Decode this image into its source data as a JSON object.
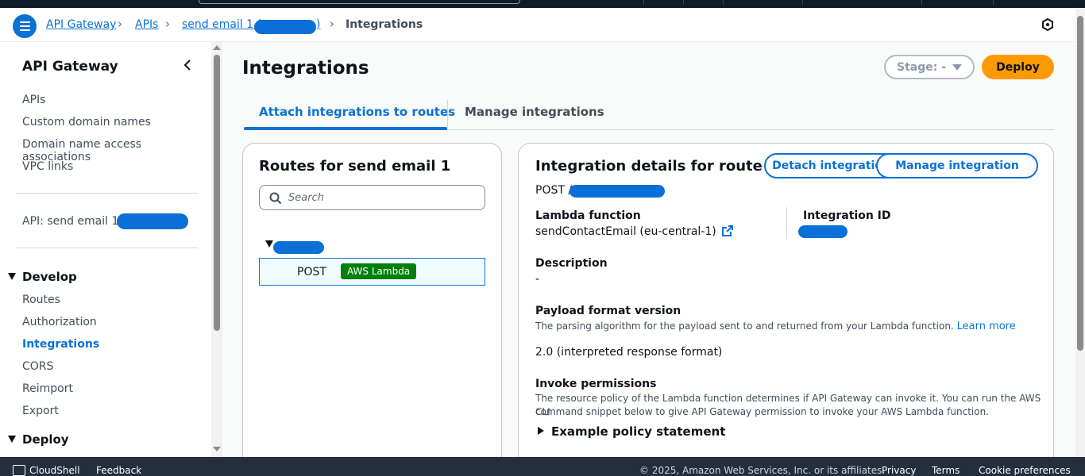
{
  "breadcrumb": {
    "items": [
      "API Gateway",
      "APIs",
      "send email 1 (",
      ")",
      "Integrations"
    ]
  },
  "sidebar": {
    "title": "API Gateway",
    "top_items": [
      "APIs",
      "Custom domain names",
      "Domain name access associations",
      "VPC links"
    ],
    "api_label": "API: send email 1...",
    "develop_label": "Develop",
    "develop_items": [
      "Routes",
      "Authorization",
      "Integrations",
      "CORS",
      "Reimport",
      "Export"
    ],
    "active_item": "Integrations",
    "deploy_label": "Deploy"
  },
  "header": {
    "title": "Integrations",
    "stage_label": "Stage: -",
    "deploy_label": "Deploy"
  },
  "tabs": [
    {
      "label": "Attach integrations to routes",
      "active": true
    },
    {
      "label": "Manage integrations",
      "active": false
    }
  ],
  "routes_panel": {
    "title": "Routes for send email 1",
    "search_placeholder": "Search",
    "route_method": "POST",
    "route_badge": "AWS Lambda"
  },
  "details": {
    "title": "Integration details for route",
    "detach_label": "Detach integration",
    "manage_label": "Manage integration",
    "route_prefix": "POST /",
    "lambda_label": "Lambda function",
    "lambda_value": "sendContactEmail (eu-central-1)",
    "integration_id_label": "Integration ID",
    "description_label": "Description",
    "description_value": "-",
    "payload_label": "Payload format version",
    "payload_help": "The parsing algorithm for the payload sent to and returned from your Lambda function.",
    "learn_more": "Learn more",
    "payload_value": "2.0 (interpreted response format)",
    "invoke_label": "Invoke permissions",
    "invoke_help_1": "The resource policy of the Lambda function determines if API Gateway can invoke it. You can run the AWS CLI",
    "invoke_help_2": "command snippet below to give API Gateway permission to invoke your AWS Lambda function.",
    "example_label": "Example policy statement"
  },
  "footer": {
    "cloudshell": "CloudShell",
    "feedback": "Feedback",
    "copyright": "© 2025, Amazon Web Services, Inc. or its affiliates.",
    "privacy": "Privacy",
    "terms": "Terms",
    "cookies": "Cookie preferences"
  },
  "colors": {
    "link": "#0972d3",
    "deploy": "#ff9900",
    "badge": "#037f0c",
    "footer_bg": "#232f3e"
  }
}
